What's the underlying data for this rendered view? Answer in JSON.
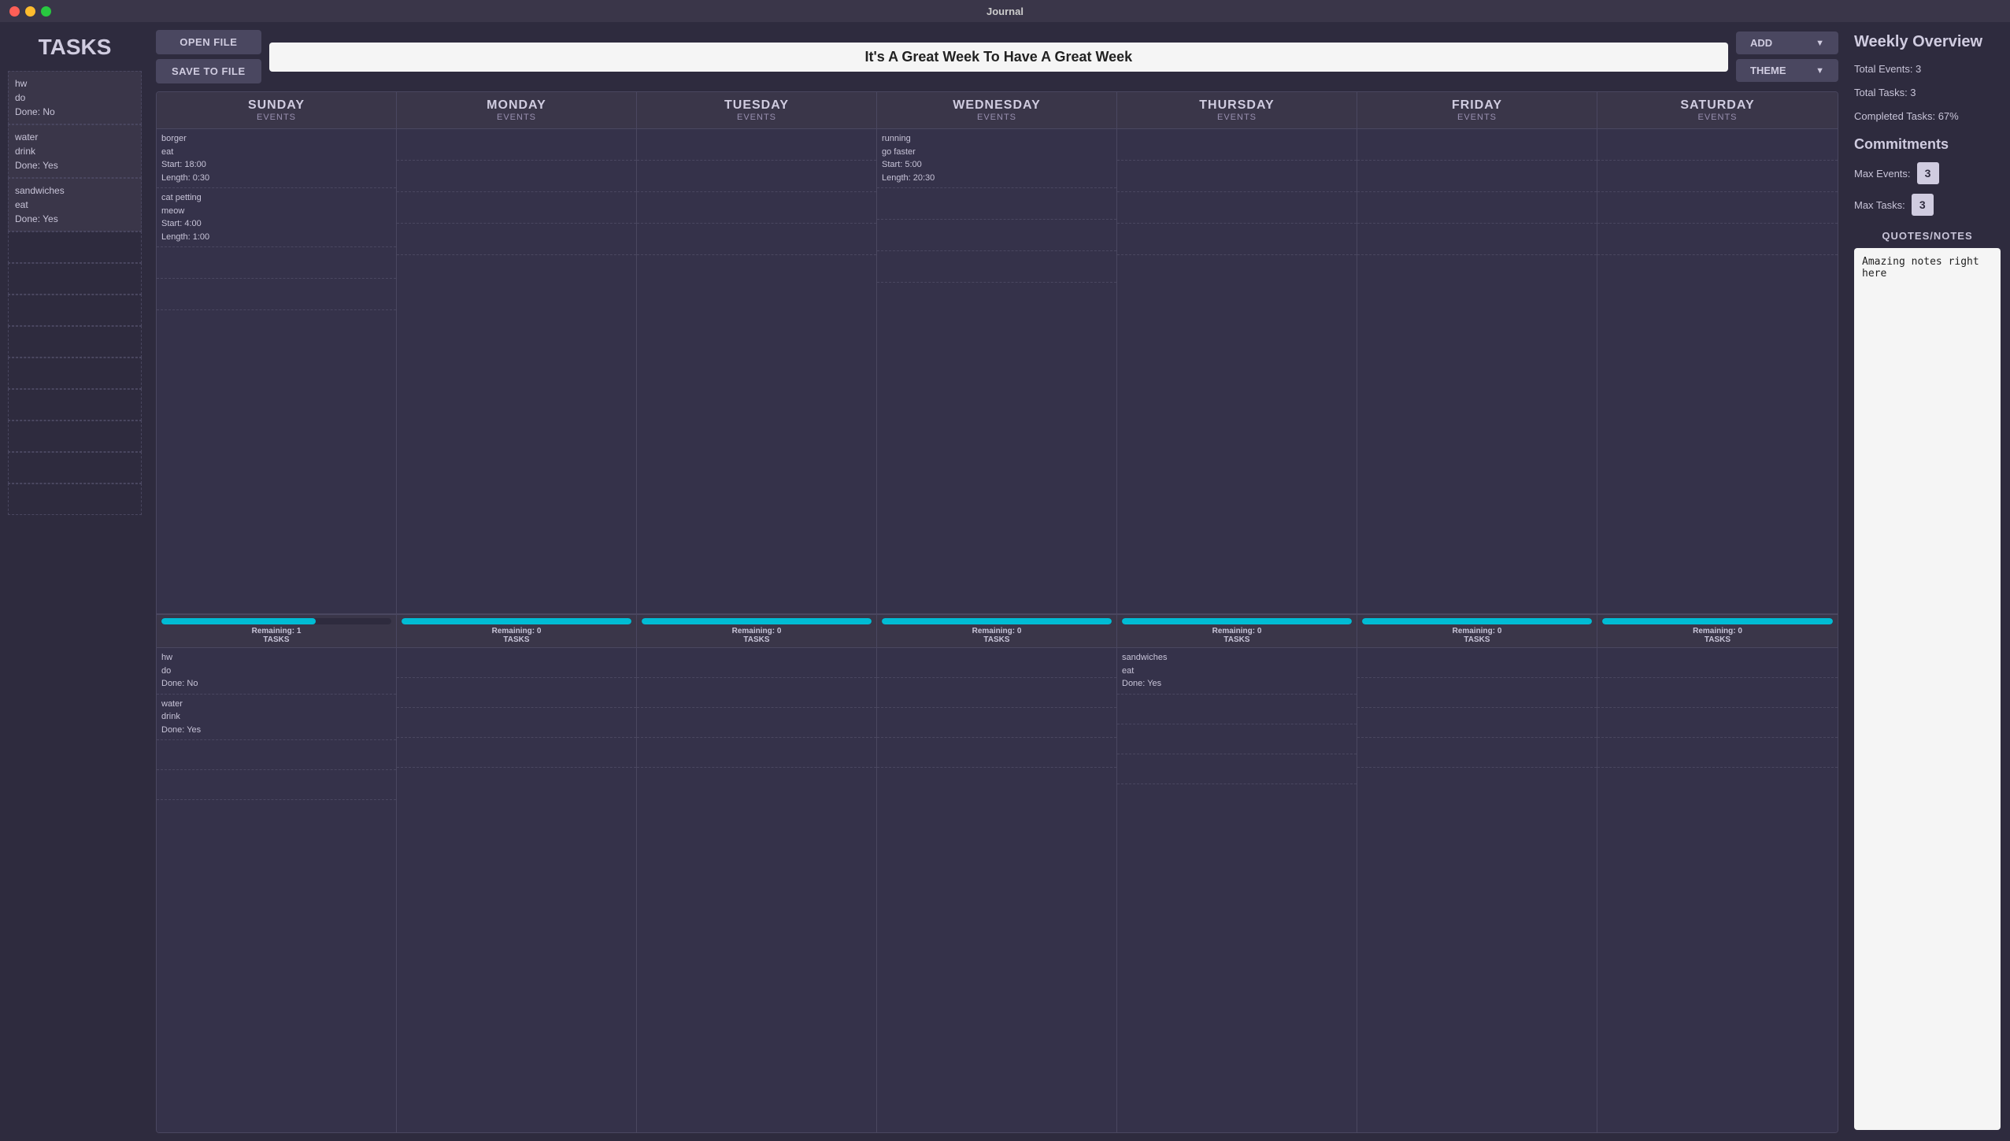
{
  "app": {
    "title": "Journal"
  },
  "sidebar": {
    "title": "TASKS",
    "tasks": [
      {
        "name": "hw",
        "detail": "do",
        "done": "Done: No"
      },
      {
        "name": "water",
        "detail": "drink",
        "done": "Done: Yes"
      },
      {
        "name": "sandwiches",
        "detail": "eat",
        "done": "Done: Yes"
      },
      {
        "empty": true
      },
      {
        "empty": true
      },
      {
        "empty": true
      },
      {
        "empty": true
      },
      {
        "empty": true
      },
      {
        "empty": true
      },
      {
        "empty": true
      },
      {
        "empty": true
      },
      {
        "empty": true
      }
    ]
  },
  "toolbar": {
    "open_file_label": "OPEN FILE",
    "save_to_file_label": "SAVE TO FILE",
    "week_title": "It's A Great Week To Have A Great Week",
    "add_label": "ADD",
    "theme_label": "THEME"
  },
  "calendar": {
    "days": [
      {
        "name": "SUNDAY",
        "events_label": "EVENTS",
        "events": [
          {
            "content": "borger\neat\nStart: 18:00\nLength: 0:30"
          },
          {
            "content": "cat petting\nmeow\nStart: 4:00\nLength: 1:00"
          },
          {
            "content": ""
          },
          {
            "content": ""
          },
          {
            "content": ""
          }
        ],
        "progress_pct": 67,
        "remaining": "Remaining: 1",
        "tasks_label": "TASKS",
        "tasks": [
          {
            "content": "hw\ndo\nDone: No"
          },
          {
            "content": "water\ndrink\nDone: Yes"
          },
          {
            "content": ""
          },
          {
            "content": ""
          },
          {
            "content": ""
          }
        ]
      },
      {
        "name": "MONDAY",
        "events_label": "EVENTS",
        "events": [
          {
            "content": ""
          },
          {
            "content": ""
          },
          {
            "content": ""
          },
          {
            "content": ""
          },
          {
            "content": ""
          }
        ],
        "progress_pct": 100,
        "remaining": "Remaining: 0",
        "tasks_label": "TASKS",
        "tasks": [
          {
            "content": ""
          },
          {
            "content": ""
          },
          {
            "content": ""
          },
          {
            "content": ""
          },
          {
            "content": ""
          }
        ]
      },
      {
        "name": "TUESDAY",
        "events_label": "EVENTS",
        "events": [
          {
            "content": ""
          },
          {
            "content": ""
          },
          {
            "content": ""
          },
          {
            "content": ""
          },
          {
            "content": ""
          }
        ],
        "progress_pct": 100,
        "remaining": "Remaining: 0",
        "tasks_label": "TASKS",
        "tasks": [
          {
            "content": ""
          },
          {
            "content": ""
          },
          {
            "content": ""
          },
          {
            "content": ""
          },
          {
            "content": ""
          }
        ]
      },
      {
        "name": "WEDNESDAY",
        "events_label": "EVENTS",
        "events": [
          {
            "content": "running\ngo faster\nStart: 5:00\nLength: 20:30"
          },
          {
            "content": ""
          },
          {
            "content": ""
          },
          {
            "content": ""
          },
          {
            "content": ""
          }
        ],
        "progress_pct": 100,
        "remaining": "Remaining: 0",
        "tasks_label": "TASKS",
        "tasks": [
          {
            "content": ""
          },
          {
            "content": ""
          },
          {
            "content": ""
          },
          {
            "content": ""
          },
          {
            "content": ""
          }
        ]
      },
      {
        "name": "THURSDAY",
        "events_label": "EVENTS",
        "events": [
          {
            "content": ""
          },
          {
            "content": ""
          },
          {
            "content": ""
          },
          {
            "content": ""
          },
          {
            "content": ""
          }
        ],
        "progress_pct": 100,
        "remaining": "Remaining: 0",
        "tasks_label": "TASKS",
        "tasks": [
          {
            "content": "sandwiches\neat\nDone: Yes"
          },
          {
            "content": ""
          },
          {
            "content": ""
          },
          {
            "content": ""
          },
          {
            "content": ""
          }
        ]
      },
      {
        "name": "FRIDAY",
        "events_label": "EVENTS",
        "events": [
          {
            "content": ""
          },
          {
            "content": ""
          },
          {
            "content": ""
          },
          {
            "content": ""
          },
          {
            "content": ""
          }
        ],
        "progress_pct": 100,
        "remaining": "Remaining: 0",
        "tasks_label": "TASKS",
        "tasks": [
          {
            "content": ""
          },
          {
            "content": ""
          },
          {
            "content": ""
          },
          {
            "content": ""
          },
          {
            "content": ""
          }
        ]
      },
      {
        "name": "SATURDAY",
        "events_label": "EVENTS",
        "events": [
          {
            "content": ""
          },
          {
            "content": ""
          },
          {
            "content": ""
          },
          {
            "content": ""
          },
          {
            "content": ""
          }
        ],
        "progress_pct": 100,
        "remaining": "Remaining: 0",
        "tasks_label": "TASKS",
        "tasks": [
          {
            "content": ""
          },
          {
            "content": ""
          },
          {
            "content": ""
          },
          {
            "content": ""
          },
          {
            "content": ""
          }
        ]
      }
    ]
  },
  "right_panel": {
    "overview_title": "Weekly Overview",
    "total_events": "Total Events: 3",
    "total_tasks": "Total Tasks: 3",
    "completed_tasks": "Completed Tasks: 67%",
    "commitments_title": "Commitments",
    "max_events_label": "Max Events:",
    "max_events_value": "3",
    "max_tasks_label": "Max Tasks:",
    "max_tasks_value": "3",
    "quotes_title": "QUOTES/NOTES",
    "notes_value": "Amazing notes right here"
  }
}
